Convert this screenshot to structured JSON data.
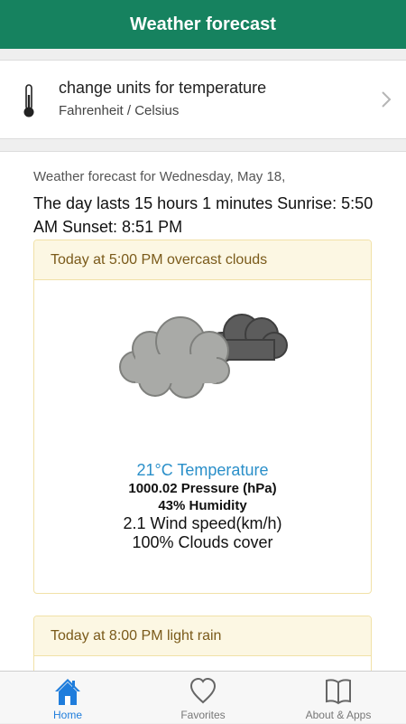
{
  "header": {
    "title": "Weather forecast"
  },
  "units": {
    "icon": "thermometer-icon",
    "title": "change units for temperature",
    "subtitle": "Fahrenheit / Celsius"
  },
  "forecast": {
    "date_line": "Weather forecast for Wednesday, May 18,",
    "day_info": "The day lasts 15 hours 1 minutes Sunrise: 5:50 AM Sunset: 8:51 PM",
    "cards": [
      {
        "heading": "Today at 5:00 PM overcast clouds",
        "icon": "overcast-clouds-icon",
        "temperature": "21°C Temperature",
        "pressure": "1000.02 Pressure (hPa)",
        "humidity": "43% Humidity",
        "wind": "2.1 Wind speed(km/h)",
        "clouds": "100% Clouds cover"
      },
      {
        "heading": "Today at 8:00 PM light rain"
      }
    ]
  },
  "tabbar": {
    "items": [
      {
        "label": "Home",
        "icon": "home-icon",
        "active": true
      },
      {
        "label": "Favorites",
        "icon": "heart-icon",
        "active": false
      },
      {
        "label": "About & Apps",
        "icon": "book-icon",
        "active": false
      }
    ]
  },
  "colors": {
    "header_bg": "#16825f",
    "card_header_bg": "#fcf7e3",
    "temperature_text": "#2a8fc9",
    "active_tab": "#1f7ddc"
  }
}
